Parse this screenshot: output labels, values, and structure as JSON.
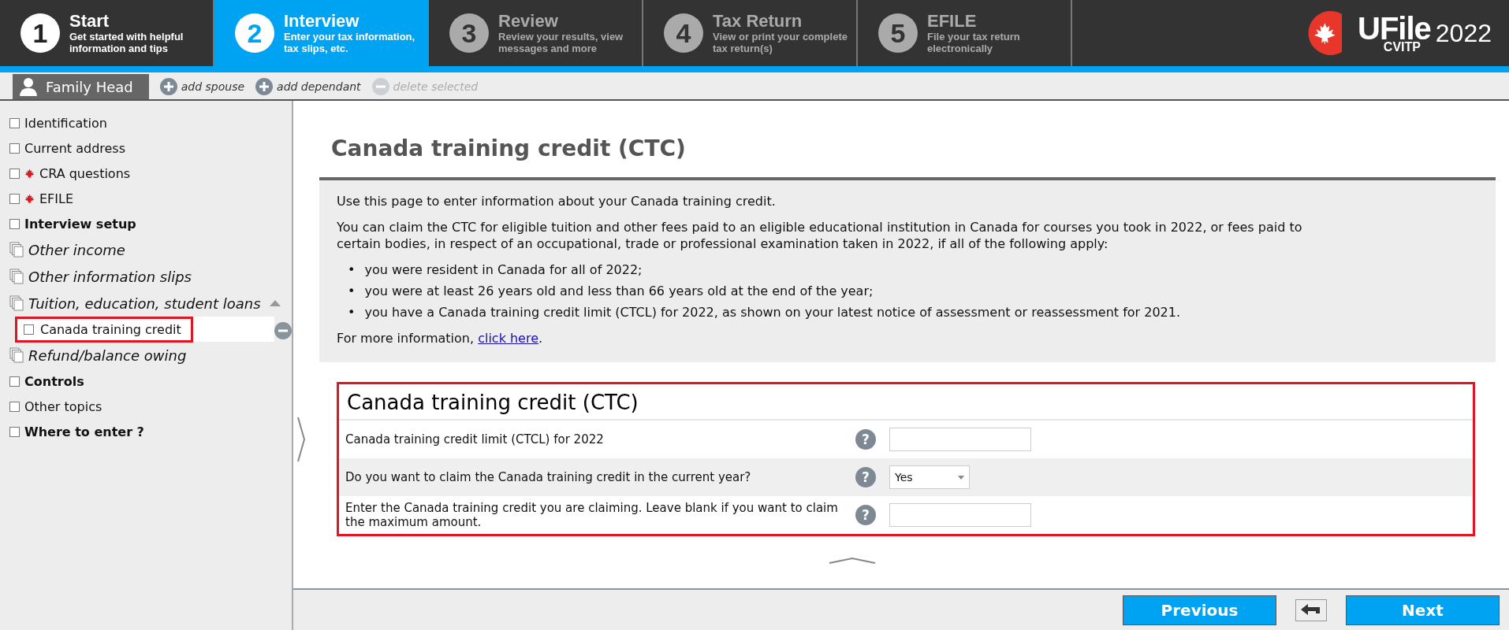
{
  "steps": [
    {
      "number": "1",
      "title": "Start",
      "subtitle": "Get started with helpful information and tips",
      "selected": false,
      "enabled": true
    },
    {
      "number": "2",
      "title": "Interview",
      "subtitle": "Enter your tax information, tax slips, etc.",
      "selected": true,
      "enabled": true
    },
    {
      "number": "3",
      "title": "Review",
      "subtitle": "Review your results, view messages and more",
      "selected": false,
      "enabled": false
    },
    {
      "number": "4",
      "title": "Tax Return",
      "subtitle": "View or print your complete tax return(s)",
      "selected": false,
      "enabled": false
    },
    {
      "number": "5",
      "title": "EFILE",
      "subtitle": "File your tax return electronically",
      "selected": false,
      "enabled": false
    }
  ],
  "logo": {
    "name": "UFile",
    "year": "2022",
    "edition": "CVITP"
  },
  "family_tabs": [
    {
      "label": "Family Head",
      "selected": true
    }
  ],
  "family_actions": [
    {
      "label": "add spouse",
      "kind": "add",
      "disabled": false
    },
    {
      "label": "add dependant",
      "kind": "add",
      "disabled": false
    },
    {
      "label": "delete selected",
      "kind": "delete",
      "disabled": true
    }
  ],
  "sidebar": {
    "items": [
      {
        "label": "Identification",
        "kind": "page",
        "checked": false,
        "bold": false,
        "flag": false,
        "selected": false
      },
      {
        "label": "Current address",
        "kind": "page",
        "checked": false,
        "bold": false,
        "flag": false,
        "selected": false
      },
      {
        "label": "CRA questions",
        "kind": "page",
        "checked": false,
        "bold": false,
        "flag": true,
        "selected": false
      },
      {
        "label": "EFILE",
        "kind": "page",
        "checked": false,
        "bold": false,
        "flag": true,
        "selected": false
      },
      {
        "label": "Interview setup",
        "kind": "page",
        "checked": false,
        "bold": true,
        "flag": false,
        "selected": false
      },
      {
        "label": "Other income",
        "kind": "group",
        "bold": false,
        "flag": false,
        "selected": false
      },
      {
        "label": "Other information slips",
        "kind": "group",
        "bold": false,
        "flag": false,
        "selected": false
      },
      {
        "label": "Tuition, education, student loans",
        "kind": "group",
        "bold": false,
        "flag": false,
        "selected": false,
        "expanded": true,
        "children": [
          {
            "label": "Canada training credit",
            "kind": "page",
            "checked": false,
            "bold": false,
            "flag": false,
            "selected": true
          }
        ]
      },
      {
        "label": "Refund/balance owing",
        "kind": "group",
        "bold": false,
        "flag": false,
        "selected": false
      },
      {
        "label": "Controls",
        "kind": "page",
        "checked": false,
        "bold": true,
        "flag": false,
        "selected": false
      },
      {
        "label": "Other topics",
        "kind": "page",
        "checked": false,
        "bold": false,
        "flag": false,
        "selected": false
      },
      {
        "label": "Where to enter ?",
        "kind": "page",
        "checked": false,
        "bold": true,
        "flag": false,
        "selected": false
      }
    ]
  },
  "page_title": "Canada training credit (CTC)",
  "info": {
    "paragraphs": [
      "Use this page to enter information about your Canada training credit.",
      "You can claim the CTC for eligible tuition and other fees paid to an eligible educational institution in Canada for courses you took in 2022, or fees paid to certain bodies, in respect of an occupational, trade or professional examination taken in 2022, if all of the following apply:"
    ],
    "marker": "•",
    "bullets": [
      "you were resident in Canada for all of 2022;",
      "you were at least 26 years old and less than 66 years old at the end of the year;",
      "you have a Canada training credit limit (CTCL) for 2022, as shown on your latest notice of assessment or reassessment for 2021."
    ],
    "more": {
      "text": "For more information,",
      "link": "click here",
      "after": "."
    }
  },
  "form": {
    "title": "Canada training credit (CTC)",
    "rows": [
      {
        "label": "Canada training credit limit (CTCL) for 2022",
        "help": "?",
        "kind": "text"
      },
      {
        "label": "Do you want to claim the Canada training credit in the current year?",
        "help": "?",
        "kind": "select",
        "value": "Yes"
      },
      {
        "label": "Enter the Canada training credit you are claiming. Leave blank if you want to claim the maximum amount.",
        "help": "?",
        "kind": "text"
      }
    ]
  },
  "buttons": {
    "previous": "Previous",
    "next": "Next"
  }
}
